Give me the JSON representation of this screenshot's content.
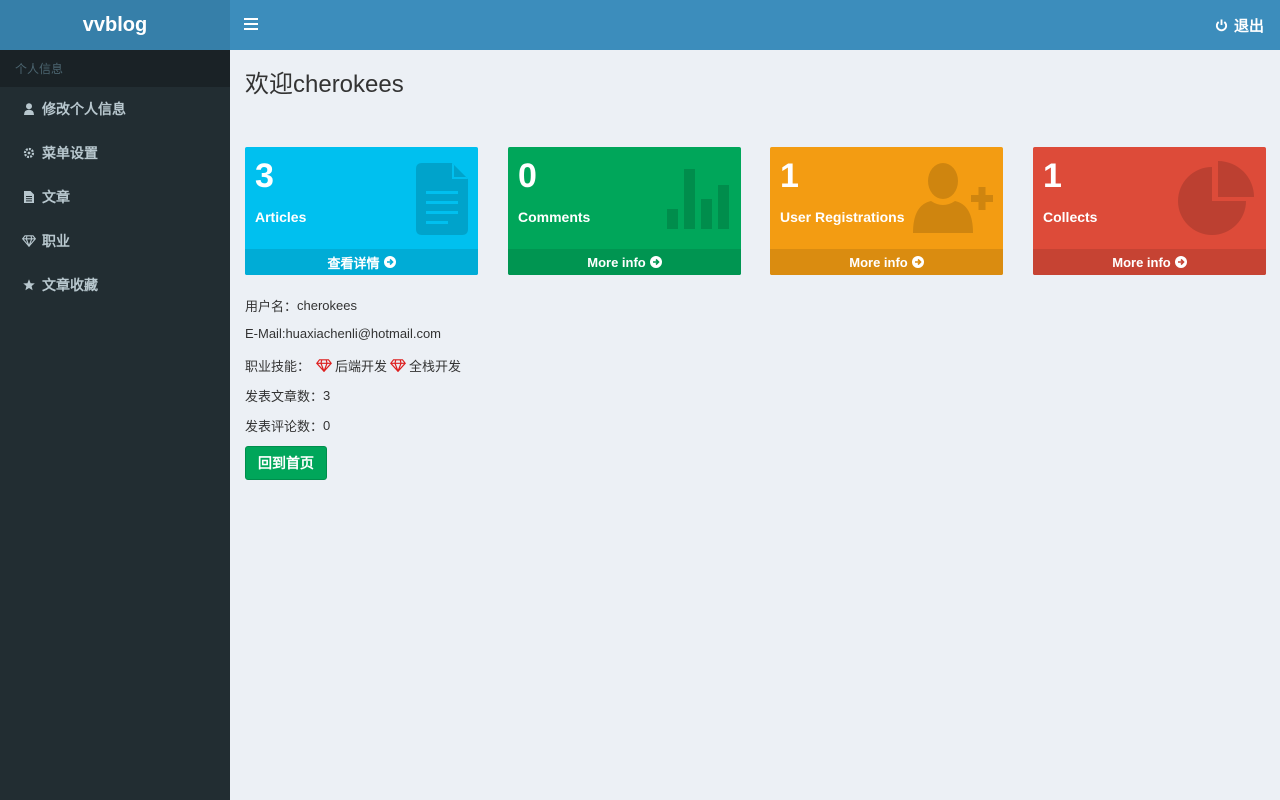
{
  "logo": "vvblog",
  "topbar": {
    "logout_label": "退出"
  },
  "sidebar": {
    "header": "个人信息",
    "items": [
      {
        "label": "修改个人信息",
        "icon": "user-icon"
      },
      {
        "label": "菜单设置",
        "icon": "gear-icon"
      },
      {
        "label": "文章",
        "icon": "file-icon"
      },
      {
        "label": "职业",
        "icon": "diamond-icon"
      },
      {
        "label": "文章收藏",
        "icon": "star-icon"
      }
    ]
  },
  "welcome": "欢迎cherokees",
  "boxes": [
    {
      "count": "3",
      "label": "Articles",
      "footer": "查看详情",
      "color": "#00c0ef",
      "footer_color": "#00acd6",
      "icon": "document-icon"
    },
    {
      "count": "0",
      "label": "Comments",
      "footer": "More info",
      "color": "#00a65a",
      "footer_color": "#009551",
      "icon": "bar-chart-icon"
    },
    {
      "count": "1",
      "label": "User Registrations",
      "footer": "More info",
      "color": "#f39c12",
      "footer_color": "#da8c10",
      "icon": "user-plus-icon"
    },
    {
      "count": "1",
      "label": "Collects",
      "footer": "More info",
      "color": "#dd4b39",
      "footer_color": "#c64333",
      "icon": "pie-chart-icon"
    }
  ],
  "profile": {
    "username_label": "用户名：",
    "username": "cherokees",
    "email_label": "E-Mail:",
    "email": "huaxiachenli@hotmail.com",
    "skills_label": "职业技能：",
    "skills": [
      "后端开发",
      "全栈开发"
    ],
    "articles_label": "发表文章数：",
    "articles": "3",
    "comments_label": "发表评论数：",
    "comments": "0"
  },
  "home_button": "回到首页"
}
